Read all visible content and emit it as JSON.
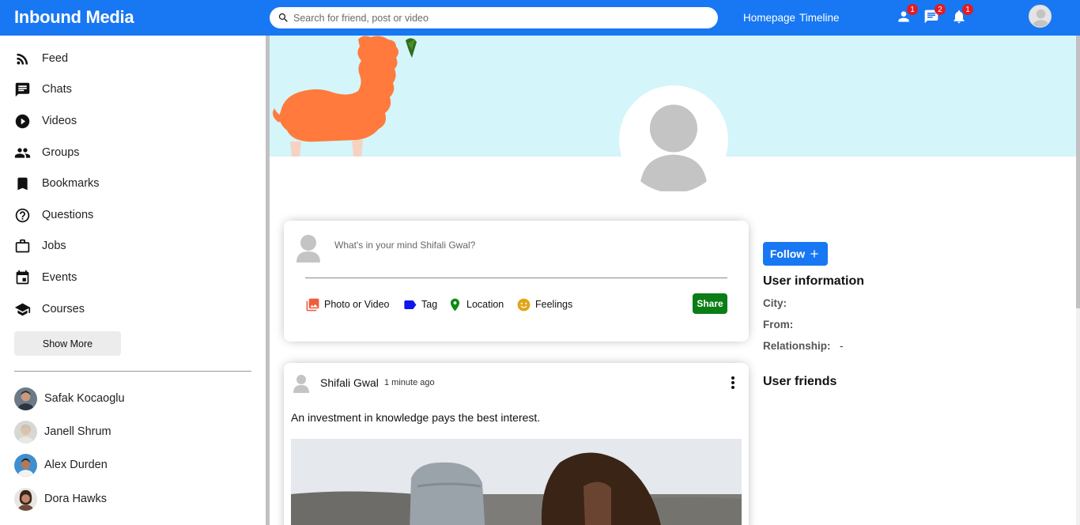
{
  "topbar": {
    "logo": "Inbound Media",
    "search_placeholder": "Search for friend, post or video",
    "links": [
      "Homepage",
      "Timeline"
    ],
    "badges": {
      "friends": "1",
      "messages": "2",
      "notifications": "1"
    },
    "color": "#1877f2"
  },
  "sidebar": {
    "items": [
      {
        "label": "Feed",
        "icon": "rss-feed-icon"
      },
      {
        "label": "Chats",
        "icon": "chat-icon"
      },
      {
        "label": "Videos",
        "icon": "play-circle-icon"
      },
      {
        "label": "Groups",
        "icon": "group-icon"
      },
      {
        "label": "Bookmarks",
        "icon": "bookmark-icon"
      },
      {
        "label": "Questions",
        "icon": "help-circle-icon"
      },
      {
        "label": "Jobs",
        "icon": "briefcase-icon"
      },
      {
        "label": "Events",
        "icon": "calendar-icon"
      },
      {
        "label": "Courses",
        "icon": "school-icon"
      }
    ],
    "show_more": "Show More",
    "friends": [
      "Safak Kocaoglu",
      "Janell Shrum",
      "Alex Durden",
      "Dora Hawks"
    ]
  },
  "share": {
    "placeholder": "What's in your mind Shifali Gwal?",
    "options": [
      "Photo or Video",
      "Tag",
      "Location",
      "Feelings"
    ],
    "option_colors": [
      "#f05d3c",
      "#1016f0",
      "#0b8a14",
      "#e3a418"
    ],
    "share_label": "Share"
  },
  "post": {
    "username": "Shifali Gwal",
    "time": "1 minute ago",
    "text": "An investment in knowledge pays the best interest."
  },
  "profile": {
    "follow_label": "Follow",
    "info_title": "User information",
    "rows": [
      {
        "label": "City:",
        "value": ""
      },
      {
        "label": "From:",
        "value": ""
      },
      {
        "label": "Relationship:",
        "value": "-"
      }
    ],
    "friends_title": "User friends"
  }
}
